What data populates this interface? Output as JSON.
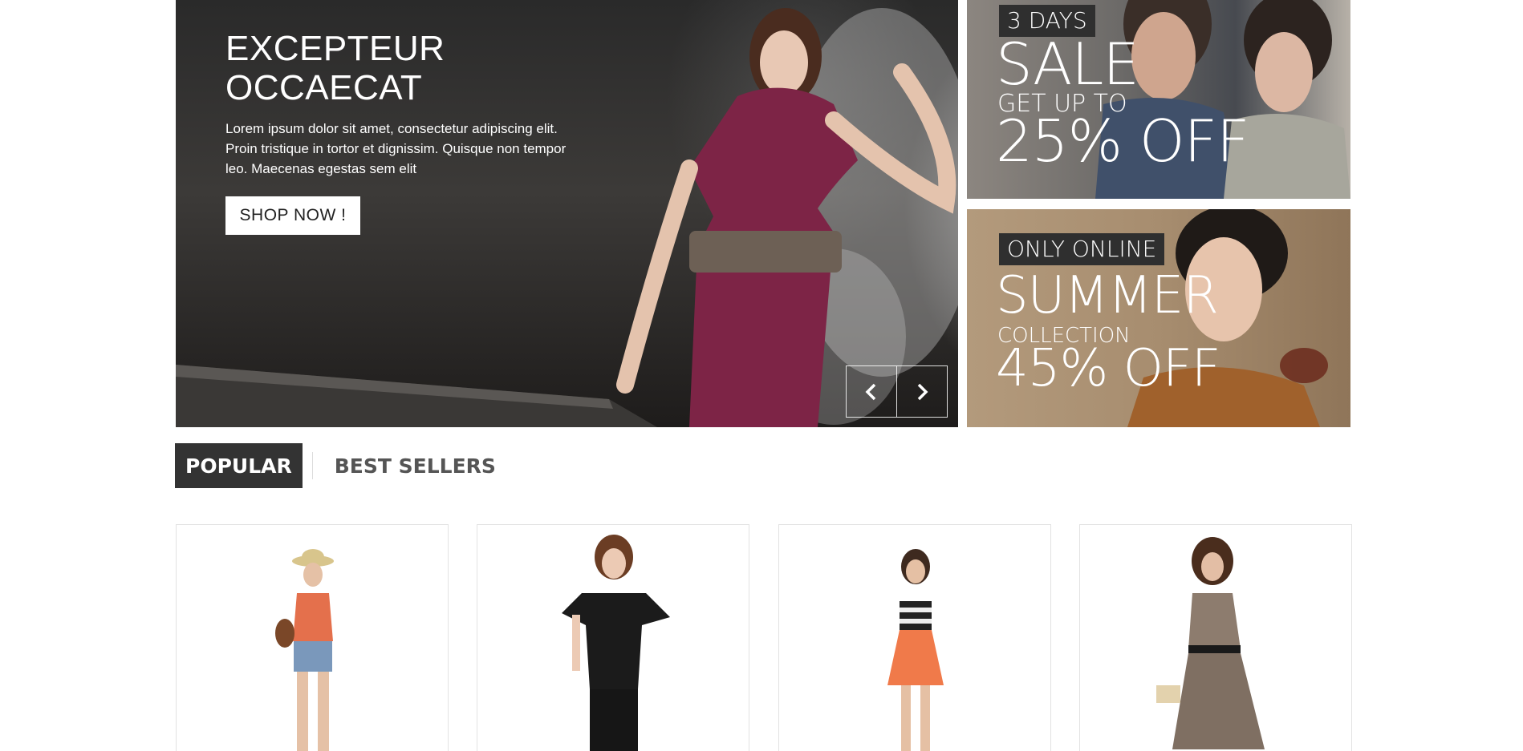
{
  "hero": {
    "title_line1": "EXCEPTEUR",
    "title_line2": "OCCAECAT",
    "description": "Lorem ipsum dolor sit amet, consectetur adipiscing elit. Proin tristique in tortor et dignissim. Quisque non tempor leo. Maecenas egestas sem elit",
    "cta_label": "SHOP NOW !",
    "prev_icon": "chevron-left-icon",
    "next_icon": "chevron-right-icon"
  },
  "banners": [
    {
      "tag": "3 DAYS",
      "headline": "SALE",
      "subline": "GET UP TO",
      "offer": "25% OFF"
    },
    {
      "tag": "ONLY ONLINE",
      "headline": "SUMMER",
      "subline": "COLLECTION",
      "offer": "45% OFF"
    }
  ],
  "tabs": [
    {
      "label": "POPULAR",
      "active": true
    },
    {
      "label": "BEST SELLERS",
      "active": false
    }
  ],
  "colors": {
    "tab_active_bg": "#333333",
    "tag_bg": "#2f2f2f",
    "dress_maroon": "#7d2446"
  }
}
